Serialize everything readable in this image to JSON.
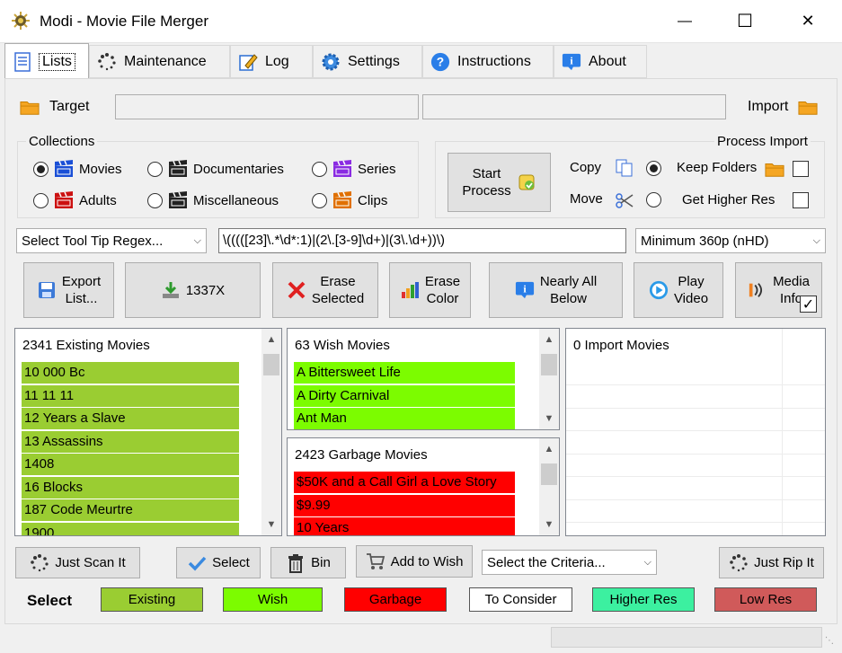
{
  "window": {
    "title": "Modi - Movie File Merger",
    "minimize": "—",
    "maximize": "☐",
    "close": "✕"
  },
  "tabs": [
    {
      "label": "Lists",
      "icon": "list-icon"
    },
    {
      "label": "Maintenance",
      "icon": "spinner-icon"
    },
    {
      "label": "Log",
      "icon": "pencil-icon"
    },
    {
      "label": "Settings",
      "icon": "gear-icon"
    },
    {
      "label": "Instructions",
      "icon": "help-icon"
    },
    {
      "label": "About",
      "icon": "info-icon"
    }
  ],
  "target": {
    "label": "Target",
    "value": "",
    "value2": ""
  },
  "import": {
    "label": "Import"
  },
  "collections": {
    "title": "Collections",
    "options": [
      {
        "label": "Movies",
        "selected": true,
        "color": "#1a4fd6"
      },
      {
        "label": "Documentaries",
        "selected": false,
        "color": "#222222"
      },
      {
        "label": "Series",
        "selected": false,
        "color": "#8a2be2"
      },
      {
        "label": "Adults",
        "selected": false,
        "color": "#cc1111"
      },
      {
        "label": "Miscellaneous",
        "selected": false,
        "color": "#222222"
      },
      {
        "label": "Clips",
        "selected": false,
        "color": "#e07000"
      }
    ]
  },
  "process_import": {
    "title": "Process Import",
    "start_label_1": "Start",
    "start_label_2": "Process",
    "copy_label": "Copy",
    "move_label": "Move",
    "keep_folders_label": "Keep Folders",
    "get_higher_res_label": "Get Higher Res",
    "copy_selected": true,
    "move_selected": false,
    "keep_folders_checked": false,
    "get_higher_res_checked": false
  },
  "filters": {
    "tooltip_regex": "Select Tool Tip Regex...",
    "regex_value": "\\(((([23]\\.*\\d*:1)|(2\\.[3-9]\\d+)|(3\\.\\d+))\\)",
    "resolution": "Minimum 360p (nHD)"
  },
  "toolbar": {
    "export_1": "Export",
    "export_2": "List...",
    "leet": "1337X",
    "erase_sel_1": "Erase",
    "erase_sel_2": "Selected",
    "erase_col_1": "Erase",
    "erase_col_2": "Color",
    "nearly_1": "Nearly All",
    "nearly_2": "Below",
    "play_1": "Play",
    "play_2": "Video",
    "media_1": "Media",
    "media_2": "Info"
  },
  "lists": {
    "existing": {
      "header": "2341 Existing Movies",
      "color": "#9acd32",
      "items": [
        "10 000 Bc",
        "11 11 11",
        "12 Years a Slave",
        "13 Assassins",
        "1408",
        "16 Blocks",
        "187 Code Meurtre",
        "1900"
      ]
    },
    "wish": {
      "header": "63 Wish Movies",
      "color": "#7cfc00",
      "items": [
        "A Bittersweet Life",
        "A Dirty Carnival",
        "Ant Man"
      ]
    },
    "garbage": {
      "header": "2423 Garbage Movies",
      "color": "#ff0000",
      "items": [
        "$50K and a Call Girl a Love Story",
        "$9.99",
        "10 Years"
      ]
    },
    "import": {
      "header": "0 Import Movies"
    }
  },
  "bottom_buttons": {
    "just_scan": "Just Scan It",
    "select": "Select",
    "bin": "Bin",
    "add_to_wish": "Add to Wish",
    "criteria": "Select the Criteria...",
    "just_rip": "Just Rip It"
  },
  "legend": {
    "label": "Select",
    "items": [
      {
        "label": "Existing",
        "color": "#9acd32"
      },
      {
        "label": "Wish",
        "color": "#7cfc00"
      },
      {
        "label": "Garbage",
        "color": "#ff0000"
      },
      {
        "label": "To Consider",
        "color": "#ffffff"
      },
      {
        "label": "Higher Res",
        "color": "#3cf0a0"
      },
      {
        "label": "Low Res",
        "color": "#d05a5a"
      }
    ]
  }
}
